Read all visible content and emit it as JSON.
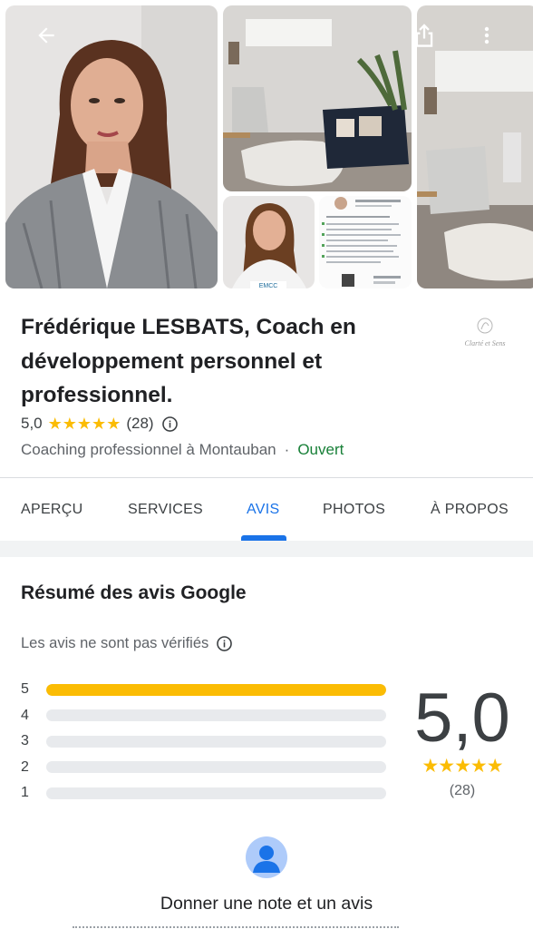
{
  "nav": {
    "back_icon": "arrow-back-icon",
    "share_icon": "share-icon",
    "more_icon": "more-vert-icon"
  },
  "place": {
    "name": "Frédérique LESBATS, Coach en développement personnel et professionnel.",
    "rating": "5,0",
    "stars": "★★★★★",
    "review_count": "(28)",
    "category": "Coaching professionnel à Montauban",
    "separator": "·",
    "open_status": "Ouvert",
    "logo_text": "Clarté et Sens"
  },
  "tabs": [
    {
      "label": "APERÇU"
    },
    {
      "label": "SERVICES"
    },
    {
      "label": "AVIS",
      "active": true
    },
    {
      "label": "PHOTOS"
    },
    {
      "label": "À PROPOS"
    }
  ],
  "summary": {
    "title": "Résumé des avis Google",
    "unverified_note": "Les avis ne sont pas vérifiés",
    "distribution": [
      {
        "stars": "5",
        "fraction": 1.0
      },
      {
        "stars": "4",
        "fraction": 0
      },
      {
        "stars": "3",
        "fraction": 0
      },
      {
        "stars": "2",
        "fraction": 0
      },
      {
        "stars": "1",
        "fraction": 0
      }
    ],
    "score": "5,0",
    "score_stars": "★★★★★",
    "score_count": "(28)"
  },
  "cta": {
    "label": "Donner une note et un avis"
  },
  "colors": {
    "accent": "#1a73e8",
    "star": "#fbbc04",
    "open": "#188038"
  }
}
